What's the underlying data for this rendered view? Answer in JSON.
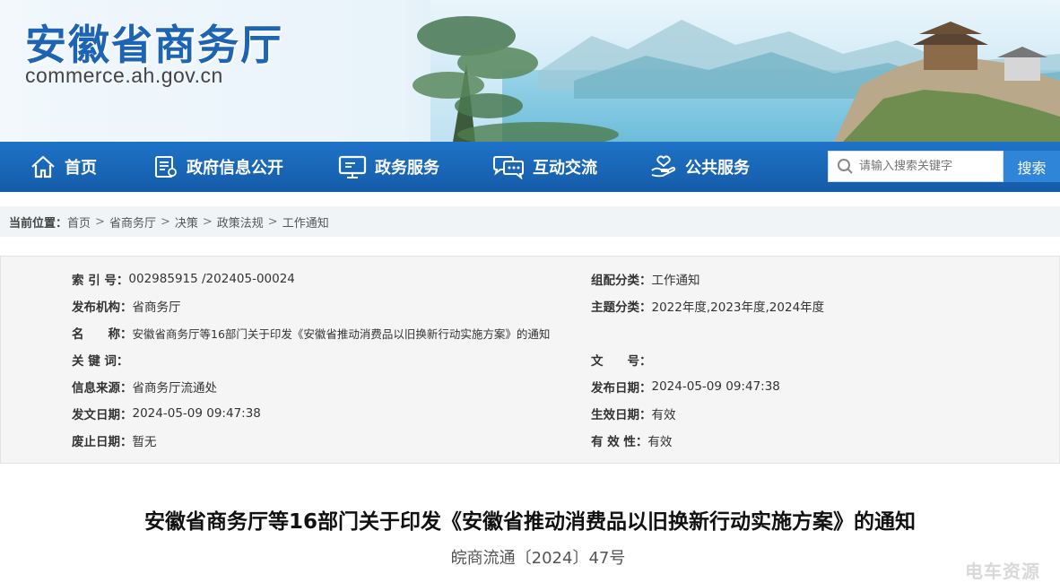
{
  "site": {
    "title": "安徽省商务厅",
    "url": "commerce.ah.gov.cn"
  },
  "nav": {
    "items": [
      {
        "label": "首页",
        "icon": "home-icon"
      },
      {
        "label": "政府信息公开",
        "icon": "document-icon"
      },
      {
        "label": "政务服务",
        "icon": "monitor-icon"
      },
      {
        "label": "互动交流",
        "icon": "chat-icon"
      },
      {
        "label": "公共服务",
        "icon": "hand-heart-icon"
      }
    ],
    "search_placeholder": "请输入搜索关键字",
    "search_button": "搜索"
  },
  "breadcrumb": {
    "label": "当前位置：",
    "items": [
      "首页",
      "省商务厅",
      "决策",
      "政策法规",
      "工作通知"
    ],
    "separator": ">"
  },
  "info": {
    "left": [
      {
        "key": "索 引 号：",
        "value": "002985915 /202405-00024"
      },
      {
        "key": "发布机构：",
        "value": "省商务厅"
      },
      {
        "key": "名　　称：",
        "value": "安徽省商务厅等16部门关于印发《安徽省推动消费品以旧换新行动实施方案》的通知"
      },
      {
        "key": "关 键 词：",
        "value": ""
      },
      {
        "key": "信息来源：",
        "value": "省商务厅流通处"
      },
      {
        "key": "发文日期：",
        "value": "2024-05-09 09:47:38"
      },
      {
        "key": "废止日期：",
        "value": "暂无"
      }
    ],
    "right": [
      {
        "key": "组配分类：",
        "value": "工作通知"
      },
      {
        "key": "主题分类：",
        "value": "2022年度,2023年度,2024年度"
      },
      {
        "key": "",
        "value": ""
      },
      {
        "key": "文　　号：",
        "value": ""
      },
      {
        "key": "发布日期：",
        "value": "2024-05-09 09:47:38"
      },
      {
        "key": "生效日期：",
        "value": "有效"
      },
      {
        "key": "有 效 性：",
        "value": "有效"
      }
    ]
  },
  "document": {
    "title": "安徽省商务厅等16部门关于印发《安徽省推动消费品以旧换新行动实施方案》的通知",
    "number": "皖商流通〔2024〕47号"
  },
  "watermark": "电车资源",
  "colors": {
    "brand_blue": "#1e64b4",
    "nav_blue": "#1a66b8",
    "search_button": "#2f86d8"
  }
}
